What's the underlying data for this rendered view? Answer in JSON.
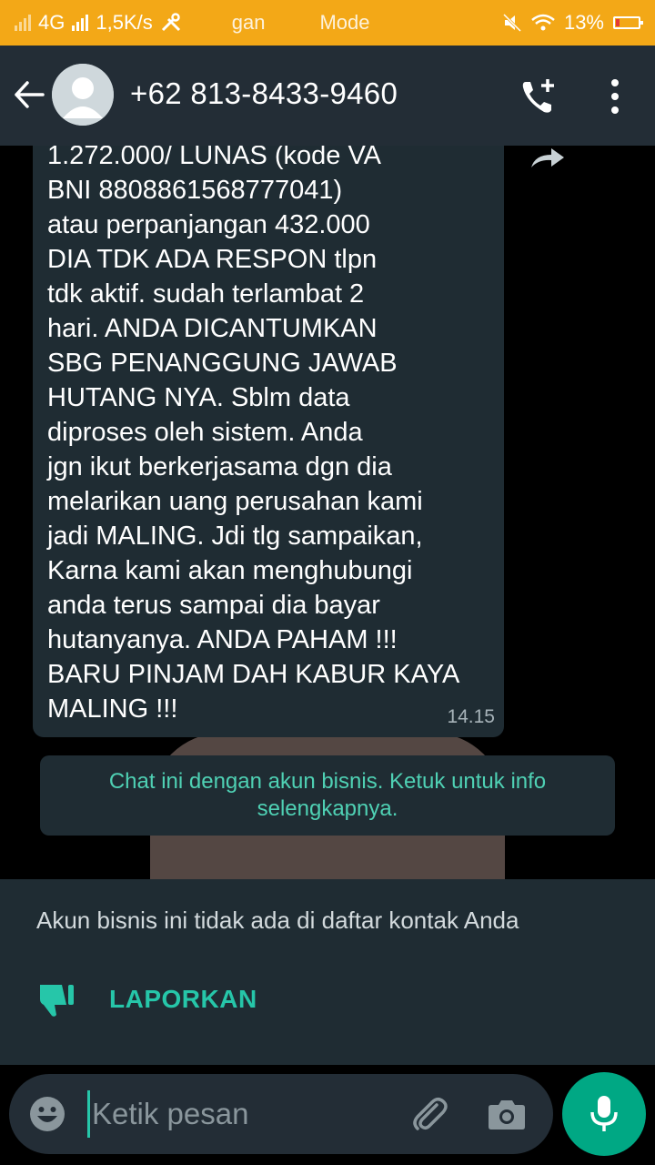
{
  "status_bar": {
    "network": "4G",
    "speed": "1,5K/s",
    "center_left": "gan",
    "center_right": "Mode",
    "battery": "13%"
  },
  "header": {
    "contact": "+62 813-8433-9460"
  },
  "message": {
    "text": "1.272.000/ LUNAS (kode VA\nBNI 8808861568777041)\natau perpanjangan 432.000\nDIA TDK ADA RESPON tlpn\ntdk aktif. sudah terlambat  2\nhari. ANDA DICANTUMKAN\nSBG PENANGGUNG JAWAB\nHUTANG NYA. Sblm data\ndiproses oleh sistem.  Anda\njgn ikut berkerjasama dgn dia\nmelarikan uang perusahan kami\njadi MALING. Jdi tlg sampaikan,\nKarna kami akan menghubungi\nanda terus sampai dia bayar\nhutanyanya. ANDA PAHAM !!!\nBARU PINJAM DAH KABUR KAYA\nMALING !!!",
    "time": "14.15"
  },
  "business_notice": "Chat ini dengan akun bisnis. Ketuk untuk info selengkapnya.",
  "report_panel": {
    "info": "Akun bisnis ini tidak ada di daftar kontak Anda",
    "report_label": "LAPORKAN"
  },
  "composer": {
    "placeholder": "Ketik pesan"
  },
  "colors": {
    "status_bar": "#f3a817",
    "header": "#232d36",
    "bubble": "#1f2c33",
    "accent": "#00a884",
    "accent_text": "#26c6a9"
  },
  "icons": [
    "back-arrow-icon",
    "avatar",
    "add-call-icon",
    "more-vert-icon",
    "forward-icon",
    "thumbs-down-icon",
    "emoji-icon",
    "attach-icon",
    "camera-icon",
    "mic-icon"
  ]
}
